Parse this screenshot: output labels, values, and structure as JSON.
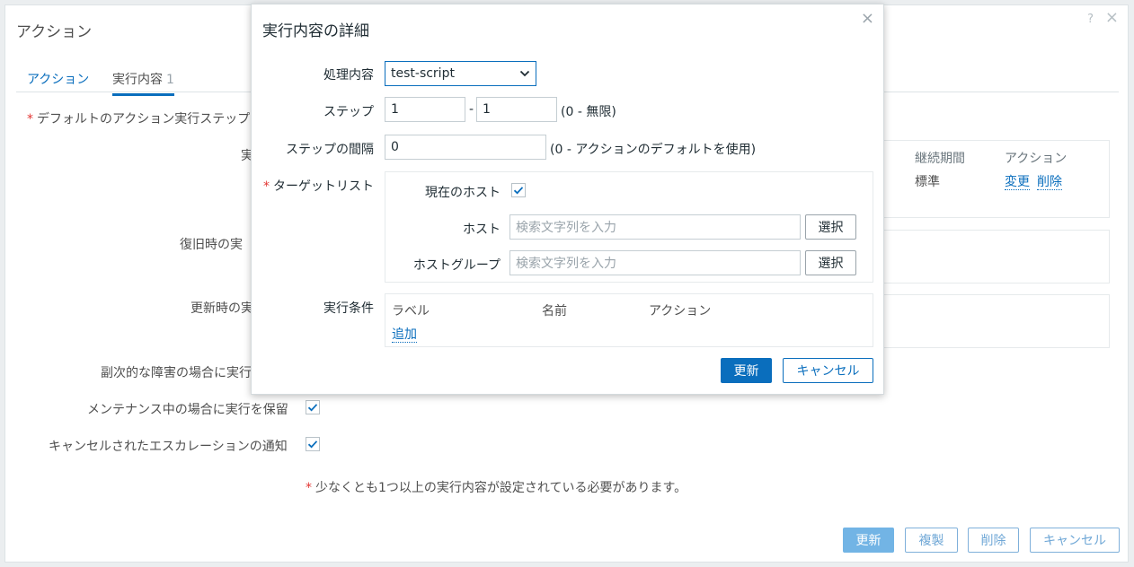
{
  "background": {
    "title": "アクション",
    "help": "?",
    "close": "×",
    "tabs": [
      {
        "label": "アクション"
      },
      {
        "label": "実行内容",
        "count": "1"
      }
    ],
    "default_step_label": "デフォルトのアクション実行ステップ",
    "operations_label": "実",
    "recovery_label": "復旧時の実",
    "update_label": "更新時の実",
    "ops_table": {
      "col_duration": "継続期間",
      "col_action": "アクション",
      "duration_value": "標準",
      "edit_link": "変更",
      "delete_link": "削除"
    },
    "secondary_label": "副次的な障害の場合に実行",
    "maintenance_label": "メンテナンス中の場合に実行を保留",
    "cancelled_label": "キャンセルされたエスカレーションの通知",
    "note": "少なくとも1つ以上の実行内容が設定されている必要があります。",
    "buttons": {
      "update": "更新",
      "clone": "複製",
      "delete": "削除",
      "cancel": "キャンセル"
    }
  },
  "modal": {
    "title": "実行内容の詳細",
    "close": "×",
    "operation_label": "処理内容",
    "operation_value": "test-script",
    "steps_label": "ステップ",
    "step_from": "1",
    "step_sep": "-",
    "step_to": "1",
    "step_hint": "(0 - 無限)",
    "interval_label": "ステップの間隔",
    "interval_value": "0",
    "interval_hint": "(0 - アクションのデフォルトを使用)",
    "target_label": "ターゲットリスト",
    "current_host_label": "現在のホスト",
    "current_host_checked": true,
    "host_label": "ホスト",
    "host_placeholder": "検索文字列を入力",
    "hostgroup_label": "ホストグループ",
    "hostgroup_placeholder": "検索文字列を入力",
    "select_button": "選択",
    "conditions_label": "実行条件",
    "cond_col_label": "ラベル",
    "cond_col_name": "名前",
    "cond_col_action": "アクション",
    "add_link": "追加",
    "update_button": "更新",
    "cancel_button": "キャンセル"
  }
}
